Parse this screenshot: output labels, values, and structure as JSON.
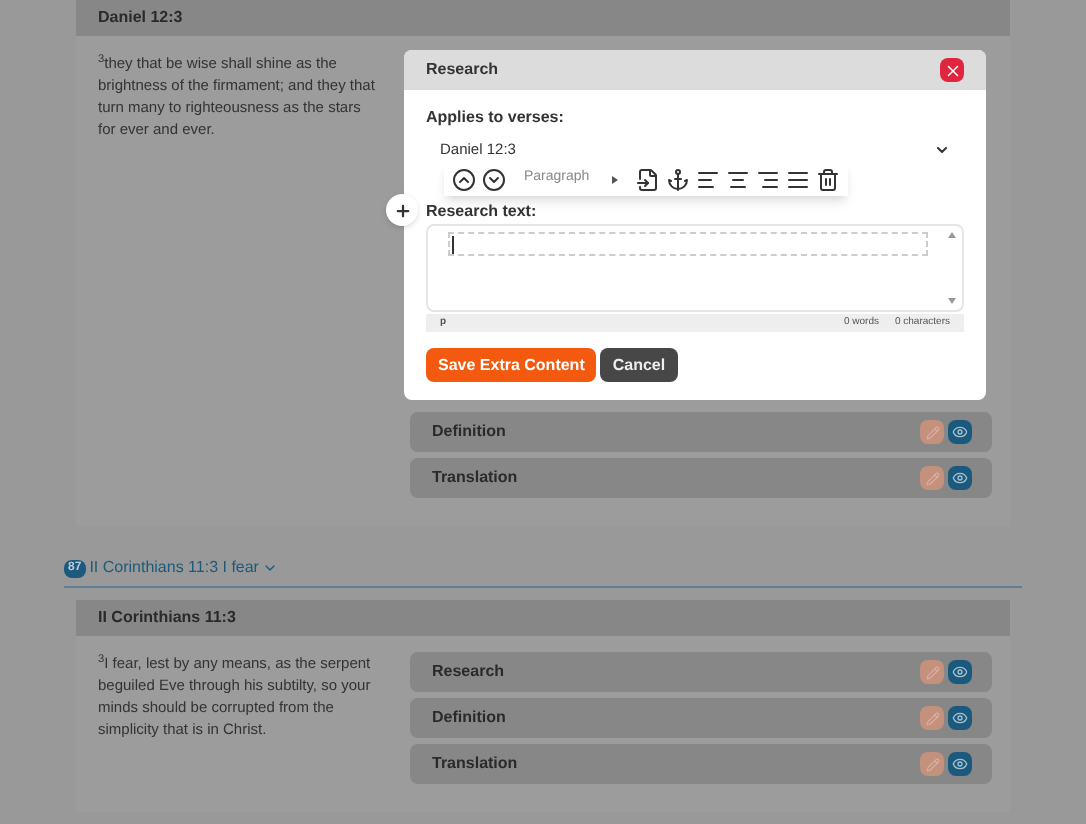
{
  "passage_1": {
    "heading": "Daniel 12:3",
    "verse_text": "$^{3}$they that be wise shall shine as the brightness of the firmament; and they that turn many to righteousness as the stars for ever and ever.",
    "sections": [
      {
        "title": "Definition"
      },
      {
        "title": "Translation"
      }
    ]
  },
  "dialog": {
    "title": "Research",
    "applies_label": "Applies to verses:",
    "verses_value": "Daniel 12:3",
    "text_label": "Research text:",
    "toolbar": {
      "format": "Paragraph"
    },
    "editor": {
      "path": "p",
      "words": "0 words",
      "characters": "0 characters"
    },
    "buttons": [
      {
        "label": "Save Extra Content",
        "kind": "primary"
      },
      {
        "label": "Cancel",
        "kind": "secondary"
      }
    ]
  },
  "group_2": {
    "badge": "87",
    "title": "II Corinthians 11:3 I fear",
    "passage": {
      "heading": "II Corinthians 11:3",
      "verse_text": "$^{3}$I fear, lest by any means, as the serpent beguiled Eve through his subtilty, so your minds should be corrupted from the simplicity that is in Christ.",
      "sections": [
        {
          "title": "Research"
        },
        {
          "title": "Definition"
        },
        {
          "title": "Translation"
        }
      ]
    }
  }
}
